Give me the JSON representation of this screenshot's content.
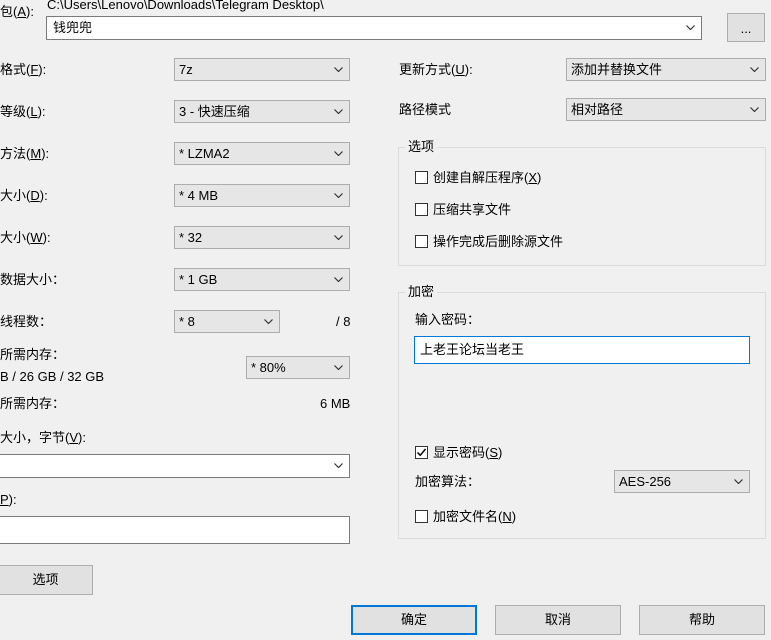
{
  "archive": {
    "label_prefix": "包(",
    "label_key": "A",
    "label_suffix": "):",
    "path": "C:\\Users\\Lenovo\\Downloads\\Telegram Desktop\\",
    "name": "钱兜兜",
    "browse_label": "..."
  },
  "left": {
    "format": {
      "label": "格式(",
      "key": "F",
      "suffix": "):",
      "value": "7z"
    },
    "level": {
      "label": "等级(",
      "key": "L",
      "suffix": "):",
      "value": "3 - 快速压缩"
    },
    "method": {
      "label": "方法(",
      "key": "M",
      "suffix": "):",
      "value": "* LZMA2"
    },
    "dict": {
      "label": "大小(",
      "key": "D",
      "suffix": "):",
      "value": "* 4 MB"
    },
    "word": {
      "label": "大小(",
      "key": "W",
      "suffix": "):",
      "value": "* 32"
    },
    "solid": {
      "label": "数据大小：",
      "value": "* 1 GB"
    },
    "threads": {
      "label": "线程数：",
      "value": "* 8",
      "max": "/ 8"
    },
    "mem_compress": {
      "label": "所需内存：",
      "detail": "B / 26 GB / 32 GB",
      "value": "* 80%"
    },
    "mem_decompress": {
      "label": "所需内存：",
      "value": "6 MB"
    },
    "split": {
      "label": "大小，字节(",
      "key": "V",
      "suffix": "):",
      "value": ""
    },
    "params": {
      "label_key": "P",
      "label_suffix": "):",
      "value": ""
    },
    "options_button": "选项"
  },
  "right": {
    "update": {
      "label": "更新方式(",
      "key": "U",
      "suffix": "):",
      "value": "添加并替换文件"
    },
    "pathmode": {
      "label": "路径模式",
      "value": "相对路径"
    },
    "options_group": {
      "title": "选项",
      "sfx": {
        "label": "创建自解压程序(",
        "key": "X",
        "suffix": ")",
        "checked": false
      },
      "shared": {
        "label": "压缩共享文件",
        "checked": false
      },
      "delete": {
        "label": "操作完成后删除源文件",
        "checked": false
      }
    },
    "encryption": {
      "title": "加密",
      "password_label": "输入密码：",
      "password_value": "上老王论坛当老王",
      "show_label": "显示密码(",
      "show_key": "S",
      "show_suffix": ")",
      "show_checked": true,
      "method_label": "加密算法：",
      "method_value": "AES-256",
      "encrypt_names_label": "加密文件名(",
      "encrypt_names_key": "N",
      "encrypt_names_suffix": ")",
      "encrypt_names_checked": false
    }
  },
  "footer": {
    "ok": "确定",
    "cancel": "取消",
    "help": "帮助"
  }
}
